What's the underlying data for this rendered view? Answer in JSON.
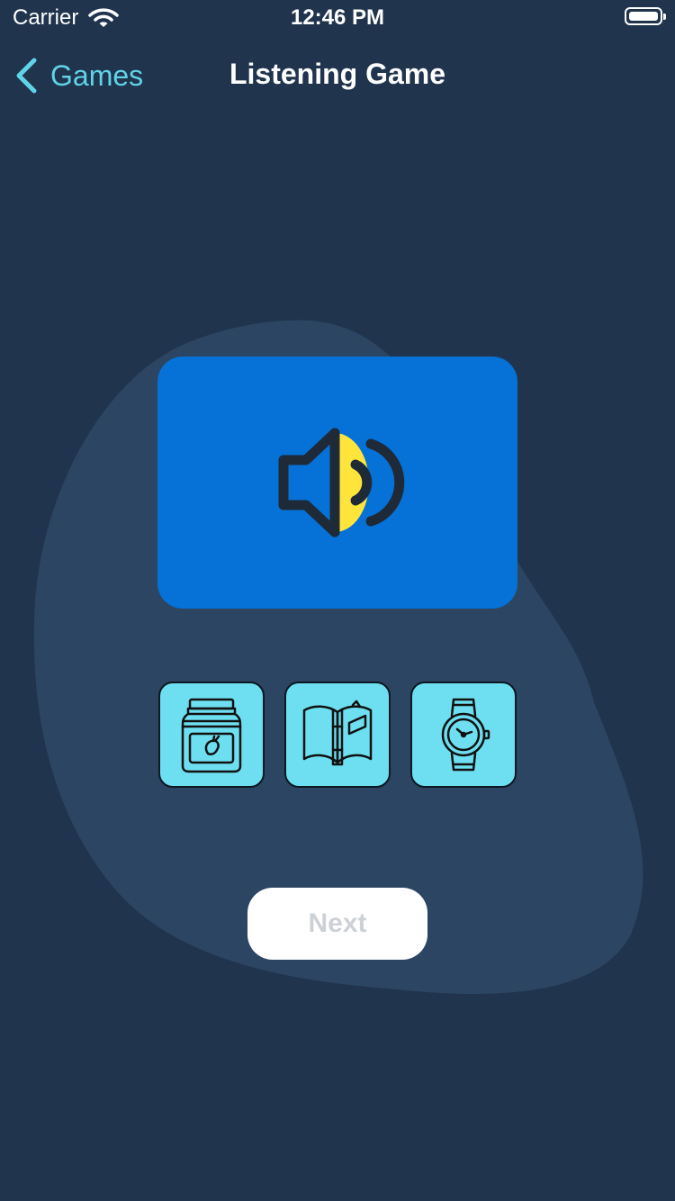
{
  "status_bar": {
    "carrier": "Carrier",
    "time": "12:46 PM"
  },
  "nav": {
    "back_label": "Games",
    "title": "Listening Game"
  },
  "sound_card": {
    "icon": "speaker-icon"
  },
  "choices": [
    {
      "icon": "jam-jar-icon"
    },
    {
      "icon": "open-book-icon"
    },
    {
      "icon": "wristwatch-icon"
    }
  ],
  "next_button": {
    "label": "Next"
  },
  "colors": {
    "background": "#21344d",
    "blob": "#2b4562",
    "accent": "#5fd3e8",
    "card": "#0671d6",
    "choice_tile": "#6ddff0",
    "speaker_yellow": "#ffe53b",
    "next_label": "#cdd1d6"
  }
}
